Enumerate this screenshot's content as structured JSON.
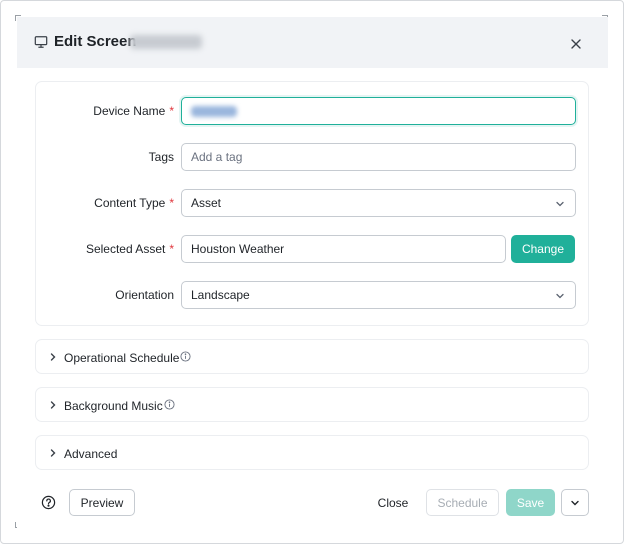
{
  "modal": {
    "title": "Edit Screen",
    "title_icon": "monitor-icon",
    "close_icon": "close-icon"
  },
  "form": {
    "device_name": {
      "label": "Device Name",
      "required_mark": "*",
      "value": ""
    },
    "tags": {
      "label": "Tags",
      "placeholder": "Add a tag"
    },
    "content_type": {
      "label": "Content Type",
      "required_mark": "*",
      "value": "Asset"
    },
    "selected_asset": {
      "label": "Selected Asset",
      "required_mark": "*",
      "value": "Houston Weather",
      "change_label": "Change"
    },
    "orientation": {
      "label": "Orientation",
      "value": "Landscape"
    }
  },
  "sections": [
    {
      "label": "Operational Schedule",
      "has_info": true
    },
    {
      "label": "Background Music",
      "has_info": true
    },
    {
      "label": "Advanced",
      "has_info": false
    }
  ],
  "footer": {
    "help_icon": "help-icon",
    "preview_label": "Preview",
    "close_label": "Close",
    "schedule_label": "Schedule",
    "save_label": "Save"
  },
  "colors": {
    "accent": "#20b09a",
    "accent_disabled": "#8fd6c9",
    "required": "#e0363c",
    "header_bg": "#f1f3f6"
  }
}
